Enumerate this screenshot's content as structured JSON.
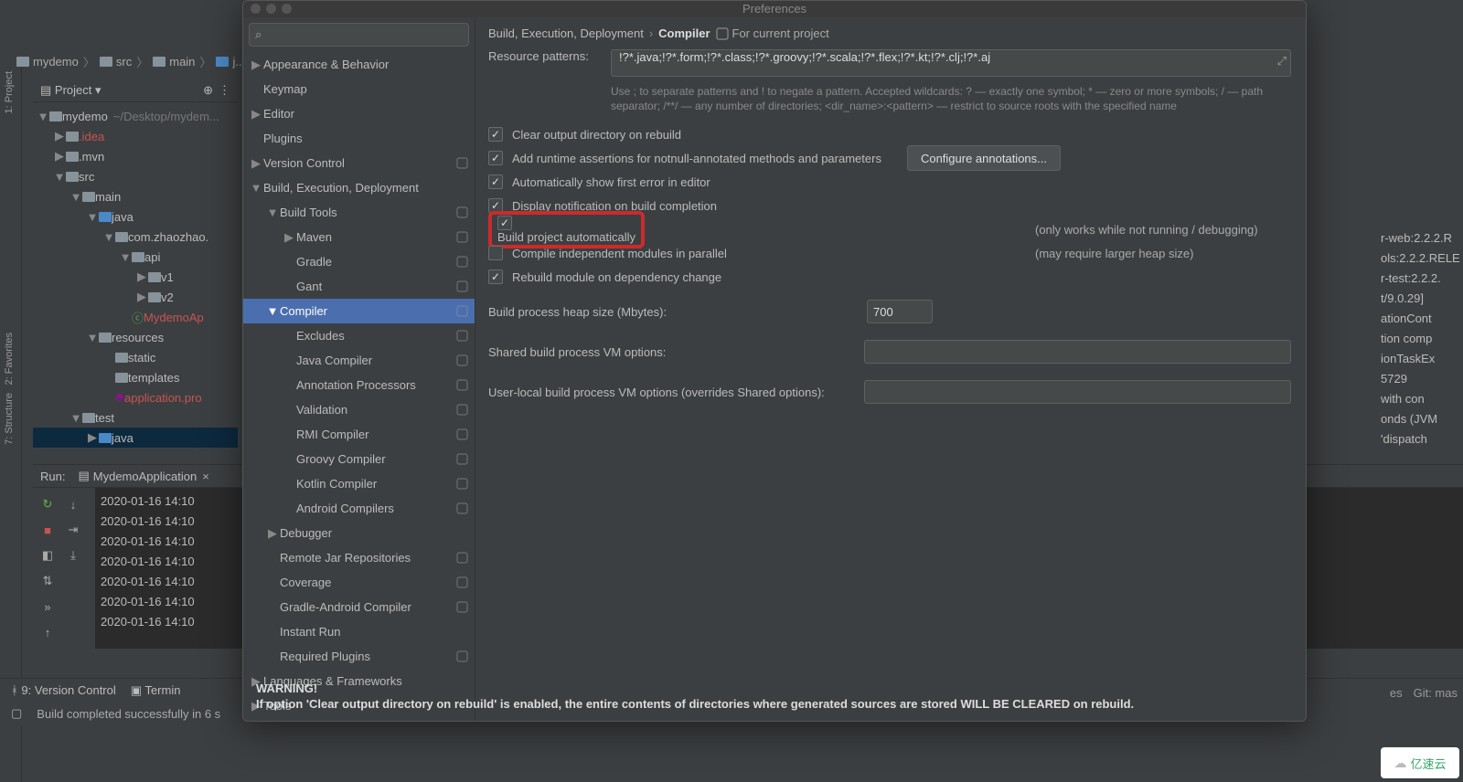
{
  "breadcrumb": [
    "mydemo",
    "src",
    "main",
    "j..."
  ],
  "projectPanel": {
    "title": "Project"
  },
  "tree": [
    {
      "d": 0,
      "a": "▼",
      "ic": "folder",
      "txt": "mydemo",
      "suf": "~/Desktop/mydem..."
    },
    {
      "d": 1,
      "a": "▶",
      "ic": "folder",
      "txt": ".idea",
      "cls": "red-txt"
    },
    {
      "d": 1,
      "a": "▶",
      "ic": "folder",
      "txt": ".mvn"
    },
    {
      "d": 1,
      "a": "▼",
      "ic": "folder",
      "txt": "src"
    },
    {
      "d": 2,
      "a": "▼",
      "ic": "folder",
      "txt": "main"
    },
    {
      "d": 3,
      "a": "▼",
      "ic": "folder-blue",
      "txt": "java"
    },
    {
      "d": 4,
      "a": "▼",
      "ic": "folder",
      "txt": "com.zhaozhao."
    },
    {
      "d": 5,
      "a": "▼",
      "ic": "folder",
      "txt": "api"
    },
    {
      "d": 6,
      "a": "▶",
      "ic": "folder",
      "txt": "v1"
    },
    {
      "d": 6,
      "a": "▶",
      "ic": "folder",
      "txt": "v2"
    },
    {
      "d": 5,
      "a": "",
      "ic": "class",
      "txt": "MydemoAp",
      "cls": "red-txt"
    },
    {
      "d": 3,
      "a": "▼",
      "ic": "folder",
      "txt": "resources"
    },
    {
      "d": 4,
      "a": "",
      "ic": "folder",
      "txt": "static"
    },
    {
      "d": 4,
      "a": "",
      "ic": "folder",
      "txt": "templates"
    },
    {
      "d": 4,
      "a": "",
      "ic": "file",
      "txt": "application.pro",
      "cls": "red-txt"
    },
    {
      "d": 2,
      "a": "▼",
      "ic": "folder",
      "txt": "test"
    },
    {
      "d": 3,
      "a": "▶",
      "ic": "folder-blue",
      "txt": "java",
      "sel": true
    }
  ],
  "sideTabs": [
    "1: Project",
    "2: Favorites",
    "7: Structure"
  ],
  "run": {
    "label": "Run:",
    "tab": "MydemoApplication"
  },
  "console": [
    "2020-01-16 14:10",
    "2020-01-16 14:10",
    "2020-01-16 14:10",
    "2020-01-16 14:10",
    "2020-01-16 14:10",
    "2020-01-16 14:10",
    "2020-01-16 14:10"
  ],
  "rightFrag": [
    "r-web:2.2.2.R",
    "ols:2.2.2.RELE",
    "r-test:2.2.2.",
    "",
    "t/9.0.29]",
    "ationCont",
    "tion comp",
    "ionTaskEx",
    "5729",
    " with con",
    "onds (JVM",
    "'dispatch"
  ],
  "statusBar": {
    "vc": "9: Version Control",
    "term": "Termin",
    "build": "Build completed successfully in 6 s"
  },
  "statusRight": {
    "es": "es",
    "git": "Git: mas"
  },
  "pref": {
    "title": "Preferences",
    "crumb": [
      "Build, Execution, Deployment",
      "Compiler"
    ],
    "projInd": "For current project",
    "searchPlaceholder": "",
    "nav": [
      {
        "d": 0,
        "a": "▶",
        "txt": "Appearance & Behavior"
      },
      {
        "d": 0,
        "a": "",
        "txt": "Keymap"
      },
      {
        "d": 0,
        "a": "▶",
        "txt": "Editor"
      },
      {
        "d": 0,
        "a": "",
        "txt": "Plugins"
      },
      {
        "d": 0,
        "a": "▶",
        "txt": "Version Control",
        "b": true
      },
      {
        "d": 0,
        "a": "▼",
        "txt": "Build, Execution, Deployment"
      },
      {
        "d": 1,
        "a": "▼",
        "txt": "Build Tools",
        "b": true
      },
      {
        "d": 2,
        "a": "▶",
        "txt": "Maven",
        "b": true
      },
      {
        "d": 2,
        "a": "",
        "txt": "Gradle",
        "b": true
      },
      {
        "d": 2,
        "a": "",
        "txt": "Gant",
        "b": true
      },
      {
        "d": 1,
        "a": "▼",
        "txt": "Compiler",
        "b": true,
        "sel": true
      },
      {
        "d": 2,
        "a": "",
        "txt": "Excludes",
        "b": true
      },
      {
        "d": 2,
        "a": "",
        "txt": "Java Compiler",
        "b": true
      },
      {
        "d": 2,
        "a": "",
        "txt": "Annotation Processors",
        "b": true
      },
      {
        "d": 2,
        "a": "",
        "txt": "Validation",
        "b": true
      },
      {
        "d": 2,
        "a": "",
        "txt": "RMI Compiler",
        "b": true
      },
      {
        "d": 2,
        "a": "",
        "txt": "Groovy Compiler",
        "b": true
      },
      {
        "d": 2,
        "a": "",
        "txt": "Kotlin Compiler",
        "b": true
      },
      {
        "d": 2,
        "a": "",
        "txt": "Android Compilers",
        "b": true
      },
      {
        "d": 1,
        "a": "▶",
        "txt": "Debugger"
      },
      {
        "d": 1,
        "a": "",
        "txt": "Remote Jar Repositories",
        "b": true
      },
      {
        "d": 1,
        "a": "",
        "txt": "Coverage",
        "b": true
      },
      {
        "d": 1,
        "a": "",
        "txt": "Gradle-Android Compiler",
        "b": true
      },
      {
        "d": 1,
        "a": "",
        "txt": "Instant Run"
      },
      {
        "d": 1,
        "a": "",
        "txt": "Required Plugins",
        "b": true
      },
      {
        "d": 0,
        "a": "▶",
        "txt": "Languages & Frameworks"
      },
      {
        "d": 0,
        "a": "▶",
        "txt": "Tools"
      }
    ],
    "resourceLabel": "Resource patterns:",
    "resourceValue": "!?*.java;!?*.form;!?*.class;!?*.groovy;!?*.scala;!?*.flex;!?*.kt;!?*.clj;!?*.aj",
    "help": "Use ; to separate patterns and ! to negate a pattern. Accepted wildcards: ? — exactly one symbol; * — zero or more symbols; / — path separator; /**/ — any number of directories; <dir_name>:<pattern> — restrict to source roots with the specified name",
    "checks": [
      {
        "on": true,
        "txt": "Clear output directory on rebuild"
      },
      {
        "on": true,
        "txt": "Add runtime assertions for notnull-annotated methods and parameters",
        "btn": "Configure annotations..."
      },
      {
        "on": true,
        "txt": "Automatically show first error in editor"
      },
      {
        "on": true,
        "txt": "Display notification on build completion"
      },
      {
        "on": true,
        "txt": "Build project automatically",
        "extra": "(only works while not running / debugging)",
        "hi": true
      },
      {
        "on": false,
        "txt": "Compile independent modules in parallel",
        "extra": "(may require larger heap size)"
      },
      {
        "on": true,
        "txt": "Rebuild module on dependency change"
      }
    ],
    "heapLabel": "Build process heap size (Mbytes):",
    "heapValue": "700",
    "sharedLabel": "Shared build process VM options:",
    "userLabel": "User-local build process VM options (overrides Shared options):",
    "warnTitle": "WARNING!",
    "warnBody": "If option 'Clear output directory on rebuild' is enabled, the entire contents of directories where generated sources are stored WILL BE CLEARED on rebuild."
  },
  "watermark": "亿速云"
}
